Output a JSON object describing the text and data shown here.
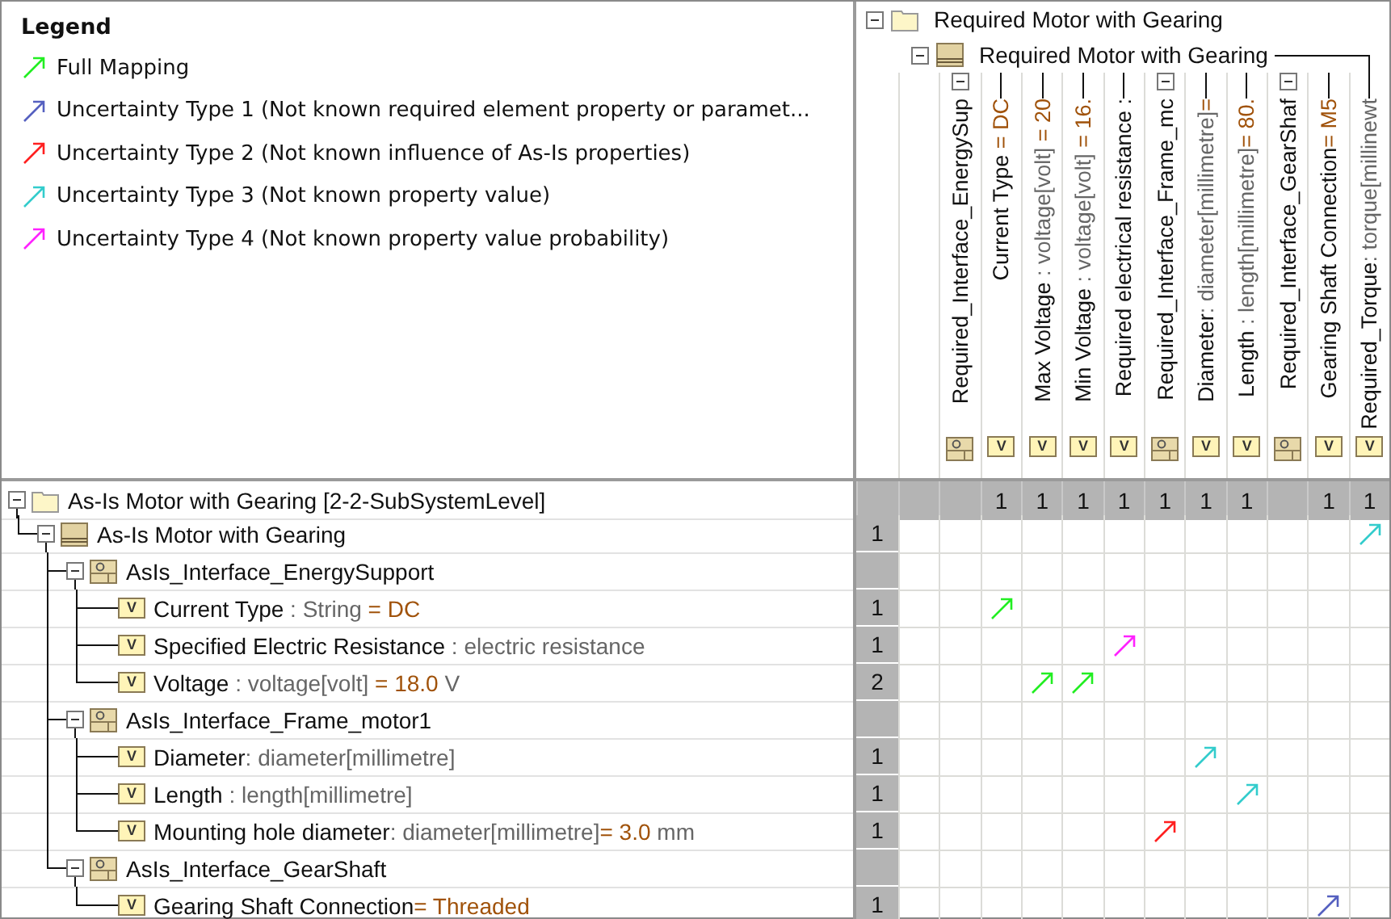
{
  "legend": {
    "title": "Legend",
    "items": [
      {
        "kind": "full",
        "label": "Full Mapping",
        "color": "#22ee22"
      },
      {
        "kind": "type1",
        "label": "Uncertainty Type 1 (Not known required element property or paramet...",
        "color": "#5560c0"
      },
      {
        "kind": "type2",
        "label": "Uncertainty Type 2 (Not known influence of As-Is properties)",
        "color": "#ff2020"
      },
      {
        "kind": "type3",
        "label": "Uncertainty Type 3 (Not known property value)",
        "color": "#33cccc"
      },
      {
        "kind": "type4",
        "label": "Uncertainty Type 4 (Not known property value probability)",
        "color": "#ff22ff"
      }
    ]
  },
  "column_tree": {
    "kind": "package",
    "name": "Required Motor with Gearing",
    "children": [
      {
        "kind": "block",
        "name": "Required Motor with Gearing",
        "children": [
          {
            "kind": "interface",
            "name": "Required_Interface_EnergySup",
            "children": [
              {
                "kind": "property",
                "icon": "V",
                "name": "Current Type",
                "value": " = DC",
                "count": "1"
              },
              {
                "kind": "property",
                "icon": "V",
                "name": "Max Voltage",
                "type": " : voltage[volt]",
                "value": " = 20",
                "count": "1"
              },
              {
                "kind": "property",
                "icon": "V",
                "name": "Min Voltage",
                "type": " : voltage[volt]",
                "value": " = 16.",
                "count": "1"
              },
              {
                "kind": "property",
                "icon": "V",
                "name": "Required electrical resistance :",
                "count": "1"
              }
            ]
          },
          {
            "kind": "interface",
            "name": "Required_Interface_Frame_mc",
            "count": "1",
            "children": [
              {
                "kind": "property",
                "icon": "V",
                "name": "Diameter",
                "type": ": diameter[millimetre]",
                "value": "=",
                "count": "1"
              },
              {
                "kind": "property",
                "icon": "V",
                "name": "Length",
                "type": " : length[millimetre]",
                "value": "= 80.",
                "count": "1"
              }
            ]
          },
          {
            "kind": "interface",
            "name": "Required_Interface_GearShaf",
            "children": [
              {
                "kind": "property",
                "icon": "V",
                "name": "Gearing Shaft Connection",
                "value": "= M5",
                "count": "1"
              }
            ]
          },
          {
            "kind": "property",
            "icon": "V",
            "name": "Required_Torque",
            "type": ": torque[millinewt",
            "count": "1"
          }
        ]
      }
    ]
  },
  "row_tree": {
    "kind": "package",
    "name": "As-Is Motor with Gearing [2-2-SubSystemLevel]",
    "children": [
      {
        "kind": "block",
        "name": "As-Is Motor with Gearing",
        "count": "1",
        "cells": [
          {
            "kind": "empty"
          },
          {
            "kind": "empty"
          },
          {
            "kind": "empty"
          },
          {
            "kind": "empty"
          },
          {
            "kind": "empty"
          },
          {
            "kind": "empty"
          },
          {
            "kind": "empty"
          },
          {
            "kind": "empty"
          },
          {
            "kind": "empty"
          },
          {
            "kind": "empty"
          },
          {
            "kind": "empty"
          },
          {
            "kind": "type3"
          }
        ],
        "children": [
          {
            "kind": "interface",
            "name": "AsIs_Interface_EnergySupport",
            "cells": [
              {
                "kind": "empty"
              },
              {
                "kind": "empty"
              },
              {
                "kind": "empty"
              },
              {
                "kind": "empty"
              },
              {
                "kind": "empty"
              },
              {
                "kind": "empty"
              },
              {
                "kind": "empty"
              },
              {
                "kind": "empty"
              },
              {
                "kind": "empty"
              },
              {
                "kind": "empty"
              },
              {
                "kind": "empty"
              },
              {
                "kind": "empty"
              }
            ],
            "children": [
              {
                "kind": "property",
                "icon": "V",
                "name": "Current Type",
                "type": " : String",
                "value": " = DC",
                "count": "1",
                "cells": [
                  {
                    "kind": "empty"
                  },
                  {
                    "kind": "empty"
                  },
                  {
                    "kind": "full"
                  },
                  {
                    "kind": "empty"
                  },
                  {
                    "kind": "empty"
                  },
                  {
                    "kind": "empty"
                  },
                  {
                    "kind": "empty"
                  },
                  {
                    "kind": "empty"
                  },
                  {
                    "kind": "empty"
                  },
                  {
                    "kind": "empty"
                  },
                  {
                    "kind": "empty"
                  },
                  {
                    "kind": "empty"
                  }
                ]
              },
              {
                "kind": "property",
                "icon": "V",
                "name": "Specified Electric Resistance",
                "type": " : electric resistance",
                "count": "1",
                "cells": [
                  {
                    "kind": "empty"
                  },
                  {
                    "kind": "empty"
                  },
                  {
                    "kind": "empty"
                  },
                  {
                    "kind": "empty"
                  },
                  {
                    "kind": "empty"
                  },
                  {
                    "kind": "type4"
                  },
                  {
                    "kind": "empty"
                  },
                  {
                    "kind": "empty"
                  },
                  {
                    "kind": "empty"
                  },
                  {
                    "kind": "empty"
                  },
                  {
                    "kind": "empty"
                  },
                  {
                    "kind": "empty"
                  }
                ]
              },
              {
                "kind": "property",
                "icon": "V",
                "name": "Voltage",
                "type": " : voltage[volt]",
                "value": " = 18.0",
                "unit": " V",
                "count": "2",
                "cells": [
                  {
                    "kind": "empty"
                  },
                  {
                    "kind": "empty"
                  },
                  {
                    "kind": "empty"
                  },
                  {
                    "kind": "full"
                  },
                  {
                    "kind": "full"
                  },
                  {
                    "kind": "empty"
                  },
                  {
                    "kind": "empty"
                  },
                  {
                    "kind": "empty"
                  },
                  {
                    "kind": "empty"
                  },
                  {
                    "kind": "empty"
                  },
                  {
                    "kind": "empty"
                  },
                  {
                    "kind": "empty"
                  }
                ]
              }
            ]
          },
          {
            "kind": "interface",
            "name": "AsIs_Interface_Frame_motor1",
            "cells": [
              {
                "kind": "empty"
              },
              {
                "kind": "empty"
              },
              {
                "kind": "empty"
              },
              {
                "kind": "empty"
              },
              {
                "kind": "empty"
              },
              {
                "kind": "empty"
              },
              {
                "kind": "empty"
              },
              {
                "kind": "empty"
              },
              {
                "kind": "empty"
              },
              {
                "kind": "empty"
              },
              {
                "kind": "empty"
              },
              {
                "kind": "empty"
              }
            ],
            "children": [
              {
                "kind": "property",
                "icon": "V",
                "name": "Diameter",
                "type": ": diameter[millimetre]",
                "count": "1",
                "cells": [
                  {
                    "kind": "empty"
                  },
                  {
                    "kind": "empty"
                  },
                  {
                    "kind": "empty"
                  },
                  {
                    "kind": "empty"
                  },
                  {
                    "kind": "empty"
                  },
                  {
                    "kind": "empty"
                  },
                  {
                    "kind": "empty"
                  },
                  {
                    "kind": "type3"
                  },
                  {
                    "kind": "empty"
                  },
                  {
                    "kind": "empty"
                  },
                  {
                    "kind": "empty"
                  },
                  {
                    "kind": "empty"
                  }
                ]
              },
              {
                "kind": "property",
                "icon": "V",
                "name": "Length",
                "type": " : length[millimetre]",
                "count": "1",
                "cells": [
                  {
                    "kind": "empty"
                  },
                  {
                    "kind": "empty"
                  },
                  {
                    "kind": "empty"
                  },
                  {
                    "kind": "empty"
                  },
                  {
                    "kind": "empty"
                  },
                  {
                    "kind": "empty"
                  },
                  {
                    "kind": "empty"
                  },
                  {
                    "kind": "empty"
                  },
                  {
                    "kind": "type3"
                  },
                  {
                    "kind": "empty"
                  },
                  {
                    "kind": "empty"
                  },
                  {
                    "kind": "empty"
                  }
                ]
              },
              {
                "kind": "property",
                "icon": "V",
                "name": "Mounting hole diameter",
                "type": ": diameter[millimetre]",
                "value": "= 3.0",
                "unit": " mm",
                "count": "1",
                "cells": [
                  {
                    "kind": "empty"
                  },
                  {
                    "kind": "empty"
                  },
                  {
                    "kind": "empty"
                  },
                  {
                    "kind": "empty"
                  },
                  {
                    "kind": "empty"
                  },
                  {
                    "kind": "empty"
                  },
                  {
                    "kind": "type2"
                  },
                  {
                    "kind": "empty"
                  },
                  {
                    "kind": "empty"
                  },
                  {
                    "kind": "empty"
                  },
                  {
                    "kind": "empty"
                  },
                  {
                    "kind": "empty"
                  }
                ]
              }
            ]
          },
          {
            "kind": "interface",
            "name": "AsIs_Interface_GearShaft",
            "cells": [
              {
                "kind": "empty"
              },
              {
                "kind": "empty"
              },
              {
                "kind": "empty"
              },
              {
                "kind": "empty"
              },
              {
                "kind": "empty"
              },
              {
                "kind": "empty"
              },
              {
                "kind": "empty"
              },
              {
                "kind": "empty"
              },
              {
                "kind": "empty"
              },
              {
                "kind": "empty"
              },
              {
                "kind": "empty"
              },
              {
                "kind": "empty"
              }
            ],
            "children": [
              {
                "kind": "property",
                "icon": "V",
                "name": "Gearing Shaft Connection",
                "value": "= Threaded",
                "count": "1",
                "cells": [
                  {
                    "kind": "empty"
                  },
                  {
                    "kind": "empty"
                  },
                  {
                    "kind": "empty"
                  },
                  {
                    "kind": "empty"
                  },
                  {
                    "kind": "empty"
                  },
                  {
                    "kind": "empty"
                  },
                  {
                    "kind": "empty"
                  },
                  {
                    "kind": "empty"
                  },
                  {
                    "kind": "empty"
                  },
                  {
                    "kind": "empty"
                  },
                  {
                    "kind": "type1"
                  },
                  {
                    "kind": "empty"
                  }
                ]
              }
            ]
          }
        ]
      }
    ]
  }
}
